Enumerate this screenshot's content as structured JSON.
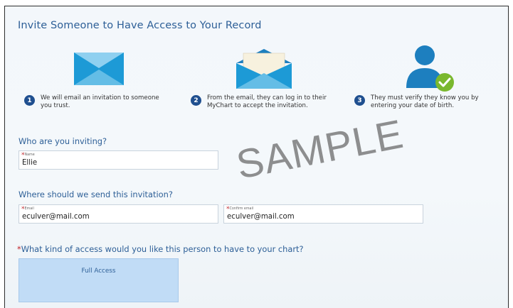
{
  "title": "Invite Someone to Have Access to Your Record",
  "steps": [
    {
      "number": "1",
      "text": "We will email an invitation to someone you trust.",
      "icon": "envelope-icon"
    },
    {
      "number": "2",
      "text": "From the email, they can log in to their MyChart to accept the invitation.",
      "icon": "open-envelope-icon"
    },
    {
      "number": "3",
      "text": "They must verify they know you by entering your date of birth.",
      "icon": "person-check-icon"
    }
  ],
  "who": {
    "heading": "Who are you inviting?",
    "name_label": "Name",
    "name_value": "Ellie"
  },
  "where": {
    "heading": "Where should we send this invitation?",
    "email_label": "Email",
    "email_value": "eculver@mail.com",
    "confirm_label": "Confirm email",
    "confirm_value": "eculver@mail.com"
  },
  "access": {
    "heading": "What kind of access would you like this person to have to your chart?",
    "option_label": "Full Access"
  },
  "required_marker": "*",
  "watermark": "SAMPLE",
  "colors": {
    "heading": "#2d5f97",
    "step_badge": "#1f4f8f",
    "envelope_light": "#8fd0f0",
    "envelope_dark": "#1d9ad6",
    "check_green": "#7ab82e",
    "required": "#c0262c",
    "selected_option": "#c1dcf6"
  }
}
